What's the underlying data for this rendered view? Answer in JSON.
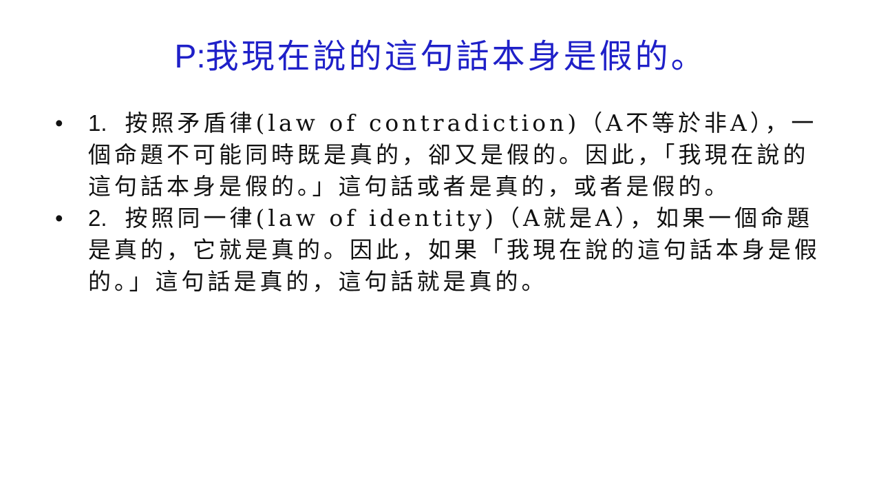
{
  "slide": {
    "title_prefix": "P:",
    "title_text": "我現在說的這句話本身是假的。",
    "bullets": [
      {
        "marker": "•",
        "number": "1.",
        "text": "按照矛盾律(law of contradiction)（A不等於非A），一個命題不可能同時既是真的，卻又是假的。因此，「我現在說的這句話本身是假的。」這句話或者是真的，或者是假的。"
      },
      {
        "marker": "•",
        "number": "2.",
        "text": "按照同一律(law of identity)（A就是A），如果一個命題是真的，它就是真的。因此，如果「我現在說的這句話本身是假的。」這句話是真的，這句話就是真的。"
      }
    ]
  }
}
